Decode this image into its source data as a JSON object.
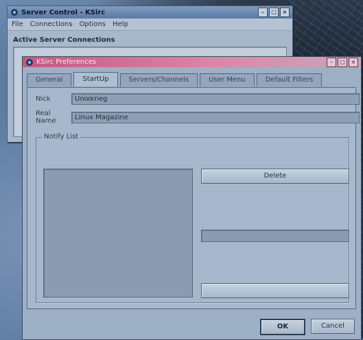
{
  "server_window": {
    "title": "Server Control - KSirc",
    "menu": [
      "File",
      "Connections",
      "Options",
      "Help"
    ],
    "section_label": "Active Server Connections"
  },
  "prefs_dialog": {
    "title": "KSirc Preferences",
    "tabs": [
      "General",
      "StartUp",
      "Servers/Channels",
      "User Menu",
      "Default Filters"
    ],
    "active_tab": "StartUp",
    "fields": {
      "nick_label": "Nick",
      "nick_value": "Unixkrieg",
      "realname_label": "Real Name",
      "realname_value": "Linux Magazine"
    },
    "notify_group_title": "Notify List",
    "delete_button": "Delete",
    "ok_button": "OK",
    "cancel_button": "Cancel"
  },
  "icons": [
    "app-icon",
    "minimize-icon",
    "maximize-icon",
    "close-icon"
  ]
}
